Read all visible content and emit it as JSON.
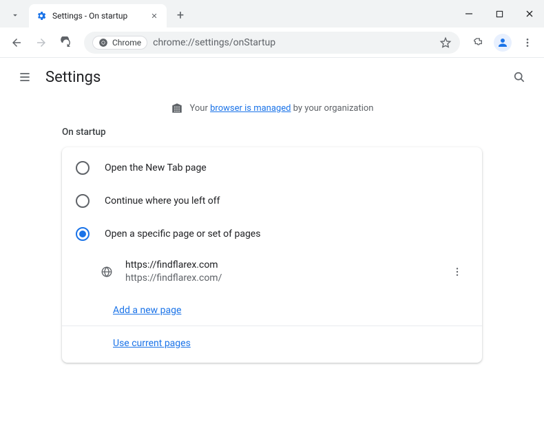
{
  "tab": {
    "title": "Settings - On startup"
  },
  "addressbar": {
    "chip": "Chrome",
    "url": "chrome://settings/onStartup"
  },
  "header": {
    "title": "Settings"
  },
  "banner": {
    "prefix": "Your ",
    "link": "browser is managed",
    "suffix": " by your organization"
  },
  "section": {
    "label": "On startup"
  },
  "options": {
    "open_new_tab": "Open the New Tab page",
    "continue": "Continue where you left off",
    "specific": "Open a specific page or set of pages"
  },
  "pages": [
    {
      "title": "https://findflarex.com",
      "url": "https://findflarex.com/"
    }
  ],
  "links": {
    "add_page": "Add a new page",
    "use_current": "Use current pages"
  }
}
